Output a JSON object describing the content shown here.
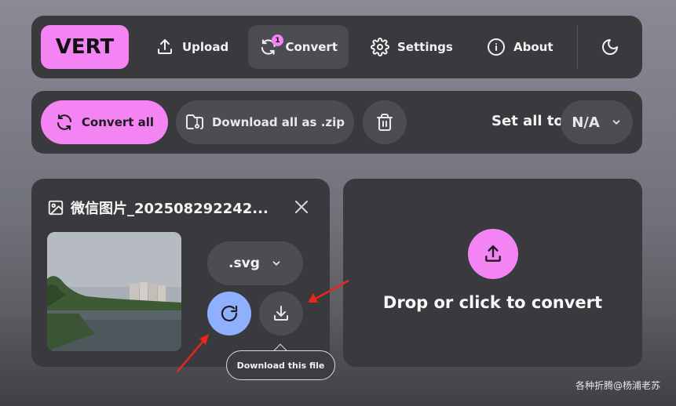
{
  "logo": {
    "text": "VERT"
  },
  "nav": {
    "upload": "Upload",
    "convert": "Convert",
    "convert_badge": "1",
    "settings": "Settings",
    "about": "About"
  },
  "actions": {
    "convert_all": "Convert all",
    "download_zip": "Download all as .zip",
    "set_all_to": "Set all to",
    "set_all_value": "N/A"
  },
  "file": {
    "name": "微信图片_202508292242...",
    "format": ".svg"
  },
  "tooltip": "Download this file",
  "dropzone": {
    "text": "Drop or click to convert"
  },
  "watermark": "各种折腾@杨浦老苏",
  "colors": {
    "accent_pink": "#f484f4",
    "accent_blue": "#8fb0ff",
    "panel": "#3a3a3e",
    "annotation_red": "#e8261c"
  }
}
